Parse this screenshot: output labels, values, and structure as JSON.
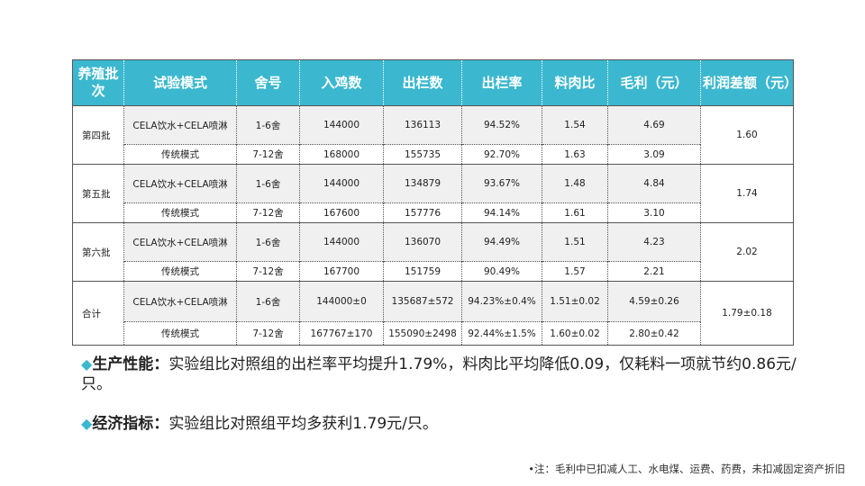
{
  "table": {
    "headers": [
      "养殖批次",
      "试验模式",
      "舍号",
      "入鸡数",
      "出栏数",
      "出栏率",
      "料肉比",
      "毛利（元）",
      "利润差额（元）"
    ],
    "groups": [
      {
        "batch": "第四批",
        "diff": "1.60",
        "rows": [
          [
            "CELA饮水+CELA喷淋",
            "1-6舍",
            "144000",
            "136113",
            "94.52%",
            "1.54",
            "4.69"
          ],
          [
            "传统模式",
            "7-12舍",
            "168000",
            "155735",
            "92.70%",
            "1.63",
            "3.09"
          ]
        ]
      },
      {
        "batch": "第五批",
        "diff": "1.74",
        "rows": [
          [
            "CELA饮水+CELA喷淋",
            "1-6舍",
            "144000",
            "134879",
            "93.67%",
            "1.48",
            "4.84"
          ],
          [
            "传统模式",
            "7-12舍",
            "167600",
            "157776",
            "94.14%",
            "1.61",
            "3.10"
          ]
        ]
      },
      {
        "batch": "第六批",
        "diff": "2.02",
        "rows": [
          [
            "CELA饮水+CELA喷淋",
            "1-6舍",
            "144000",
            "136070",
            "94.49%",
            "1.51",
            "4.23"
          ],
          [
            "传统模式",
            "7-12舍",
            "167700",
            "151759",
            "90.49%",
            "1.57",
            "2.21"
          ]
        ]
      },
      {
        "batch": "合计",
        "diff": "1.79±0.18",
        "rows": [
          [
            "CELA饮水+CELA喷淋",
            "1-6舍",
            "144000±0",
            "135687±572",
            "94.23%±0.4%",
            "1.51±0.02",
            "4.59±0.26"
          ],
          [
            "传统模式",
            "7-12舍",
            "167767±170",
            "155090±2498",
            "92.44%±1.5%",
            "1.60±0.02",
            "2.80±0.42"
          ]
        ]
      }
    ]
  },
  "notes": {
    "bullet": "◆",
    "performance_label": "生产性能：",
    "performance_text": "实验组比对照组的出栏率平均提升1.79%，料肉比平均降低0.09，仅耗料一项就节约0.86元/只。",
    "economic_label": "经济指标：",
    "economic_text": "实验组比对照组平均多获利1.79元/只。"
  },
  "footnote": "•注：毛利中已扣减人工、水电煤、运费、药费，未扣减固定资产折旧",
  "colors": {
    "header_bg": "#3bb8cf",
    "shaded_row": "#f0f0f0"
  }
}
